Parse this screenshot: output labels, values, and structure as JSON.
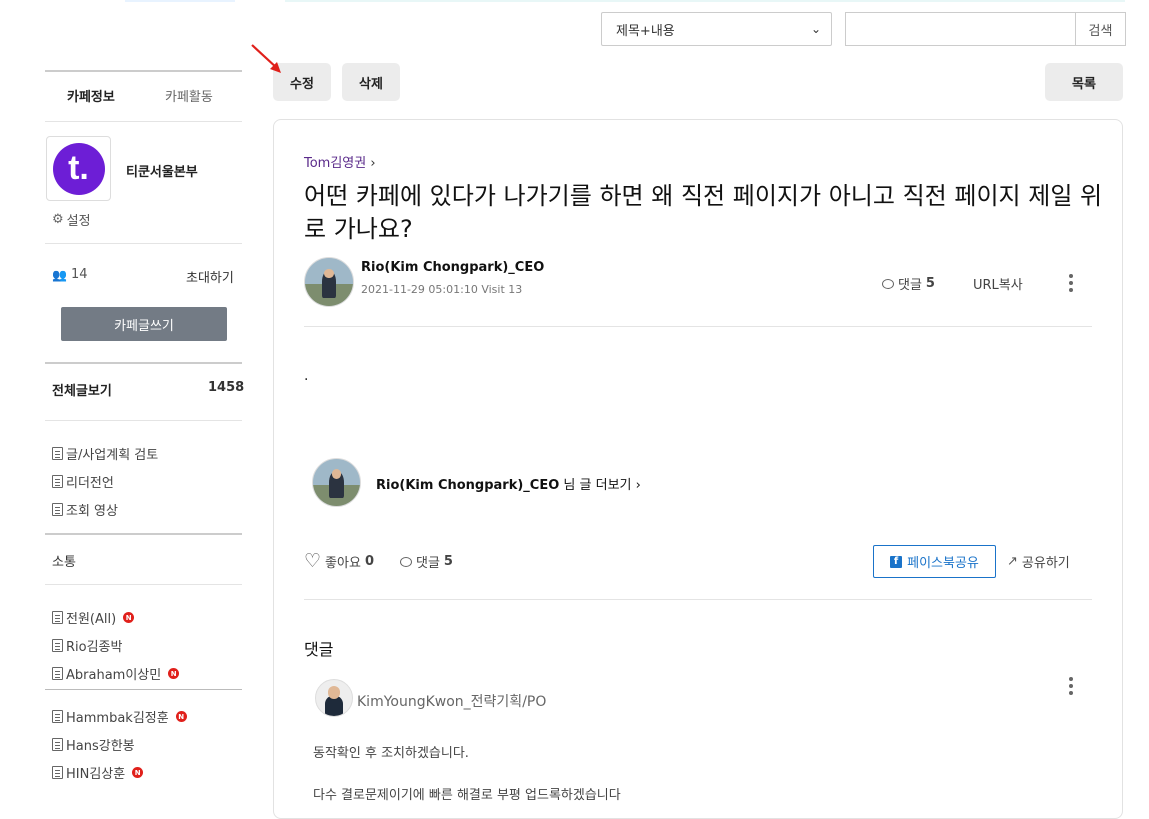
{
  "search": {
    "select_value": "제목+내용",
    "button_label": "검색",
    "input_value": ""
  },
  "sidebar": {
    "tabs": [
      "카페정보",
      "카페활동"
    ],
    "cafe_name": "티쿤서울본부",
    "settings_label": "설정",
    "member_count": "14",
    "invite_label": "초대하기",
    "write_button": "카페글쓰기",
    "all_posts_label": "전체글보기",
    "all_posts_count": "1458",
    "menu_group1": [
      "글/사업계획 검토",
      "리더전언",
      "조회 영상"
    ],
    "section_label": "소통",
    "menu_group2": [
      {
        "label": "전원(All)",
        "new": true
      },
      {
        "label": "Rio김종박",
        "new": false
      },
      {
        "label": "Abraham이상민",
        "new": true
      }
    ],
    "menu_group3": [
      {
        "label": "Hammbak김정훈",
        "new": true
      },
      {
        "label": "Hans강한봉",
        "new": false
      },
      {
        "label": "HIN김상훈",
        "new": true
      }
    ],
    "new_badge": "N",
    "logo_letter": "t."
  },
  "actions": {
    "edit": "수정",
    "delete": "삭제",
    "list": "목록"
  },
  "post": {
    "board_link": "Tom김영권",
    "title": "어떤 카페에 있다가 나가기를 하면 왜 직전 페이지가 아니고 직전 페이지 제일 위로 가나요?",
    "writer": "Rio(Kim Chongpark)_CEO",
    "meta": "2021-11-29 05:01:10 Visit 13",
    "comment_label": "댓글",
    "comment_count": "5",
    "url_copy": "URL복사",
    "body": ".",
    "more_writer": "Rio(Kim Chongpark)_CEO",
    "more_suffix": "님 글 더보기",
    "like_label": "좋아요",
    "like_count": "0",
    "facebook_share": "페이스북공유",
    "share": "공유하기"
  },
  "comments": {
    "title": "댓글",
    "items": [
      {
        "author": "KimYoungKwon_전략기획/PO",
        "lines": [
          "동작확인 후 조치하겠습니다.",
          "다수 결로문제이기에 빠른 해결로 부평 업드록하겠습니다"
        ]
      }
    ]
  },
  "colors": {
    "accent_purple": "#6d1ed6",
    "facebook_blue": "#1a73c9",
    "new_badge_red": "#e0201b",
    "annotation_arrow": "#e0201b"
  }
}
